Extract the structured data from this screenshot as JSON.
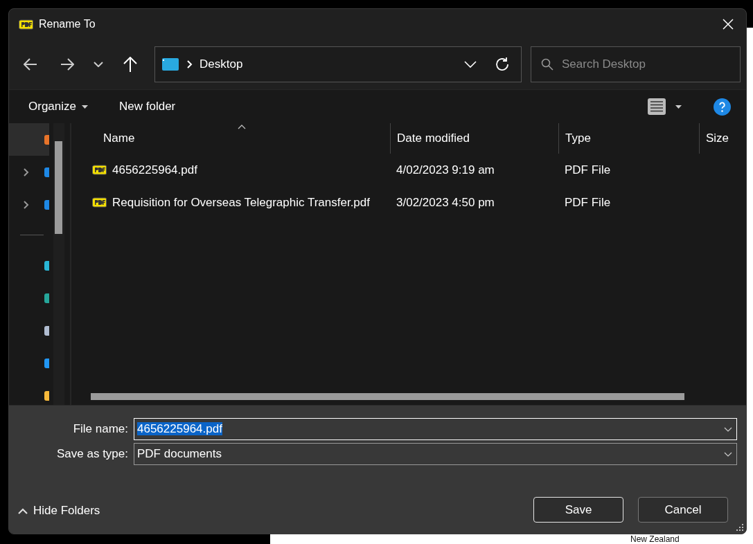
{
  "window": {
    "title": "Rename To"
  },
  "nav": {
    "path": "Desktop",
    "search": {
      "placeholder": "Search Desktop"
    }
  },
  "toolbar": {
    "organize": "Organize",
    "new_folder": "New folder"
  },
  "sidebar": {
    "items": [
      {
        "kind": "location",
        "selected": true,
        "color": "#e8742a"
      },
      {
        "kind": "tree",
        "expanded": false,
        "selected": false,
        "color": "#1e88e5"
      },
      {
        "kind": "tree",
        "expanded": false,
        "selected": false,
        "color": "#1e88e5"
      },
      {
        "kind": "separator"
      },
      {
        "kind": "location",
        "selected": false,
        "color": "#29b6d6"
      },
      {
        "kind": "location",
        "selected": false,
        "color": "#26a69a"
      },
      {
        "kind": "location",
        "selected": false,
        "color": "#b0bcd0"
      },
      {
        "kind": "location",
        "selected": false,
        "color": "#2196f3"
      },
      {
        "kind": "location",
        "selected": false,
        "color": "#f6b93b"
      }
    ]
  },
  "table": {
    "columns": [
      {
        "label": "Name",
        "sorted": true
      },
      {
        "label": "Date modified",
        "sorted": false
      },
      {
        "label": "Type",
        "sorted": false
      },
      {
        "label": "Size",
        "sorted": false
      }
    ],
    "rows": [
      {
        "name": "4656225964.pdf",
        "date": "4/02/2023 9:19 am",
        "type": "PDF File"
      },
      {
        "name": "Requisition for Overseas Telegraphic Transfer.pdf",
        "date": "3/02/2023 4:50 pm",
        "type": "PDF File"
      }
    ]
  },
  "form": {
    "file_name": {
      "label": "File name:",
      "value": "4656225964.pdf",
      "selected": true
    },
    "save_type": {
      "label": "Save as type:",
      "value": "PDF documents"
    }
  },
  "hide_folders": "Hide Folders",
  "buttons": [
    {
      "label": "Save",
      "kind": "default"
    },
    {
      "label": "Cancel",
      "kind": "normal"
    }
  ],
  "background": {
    "text": "New Zealand"
  }
}
